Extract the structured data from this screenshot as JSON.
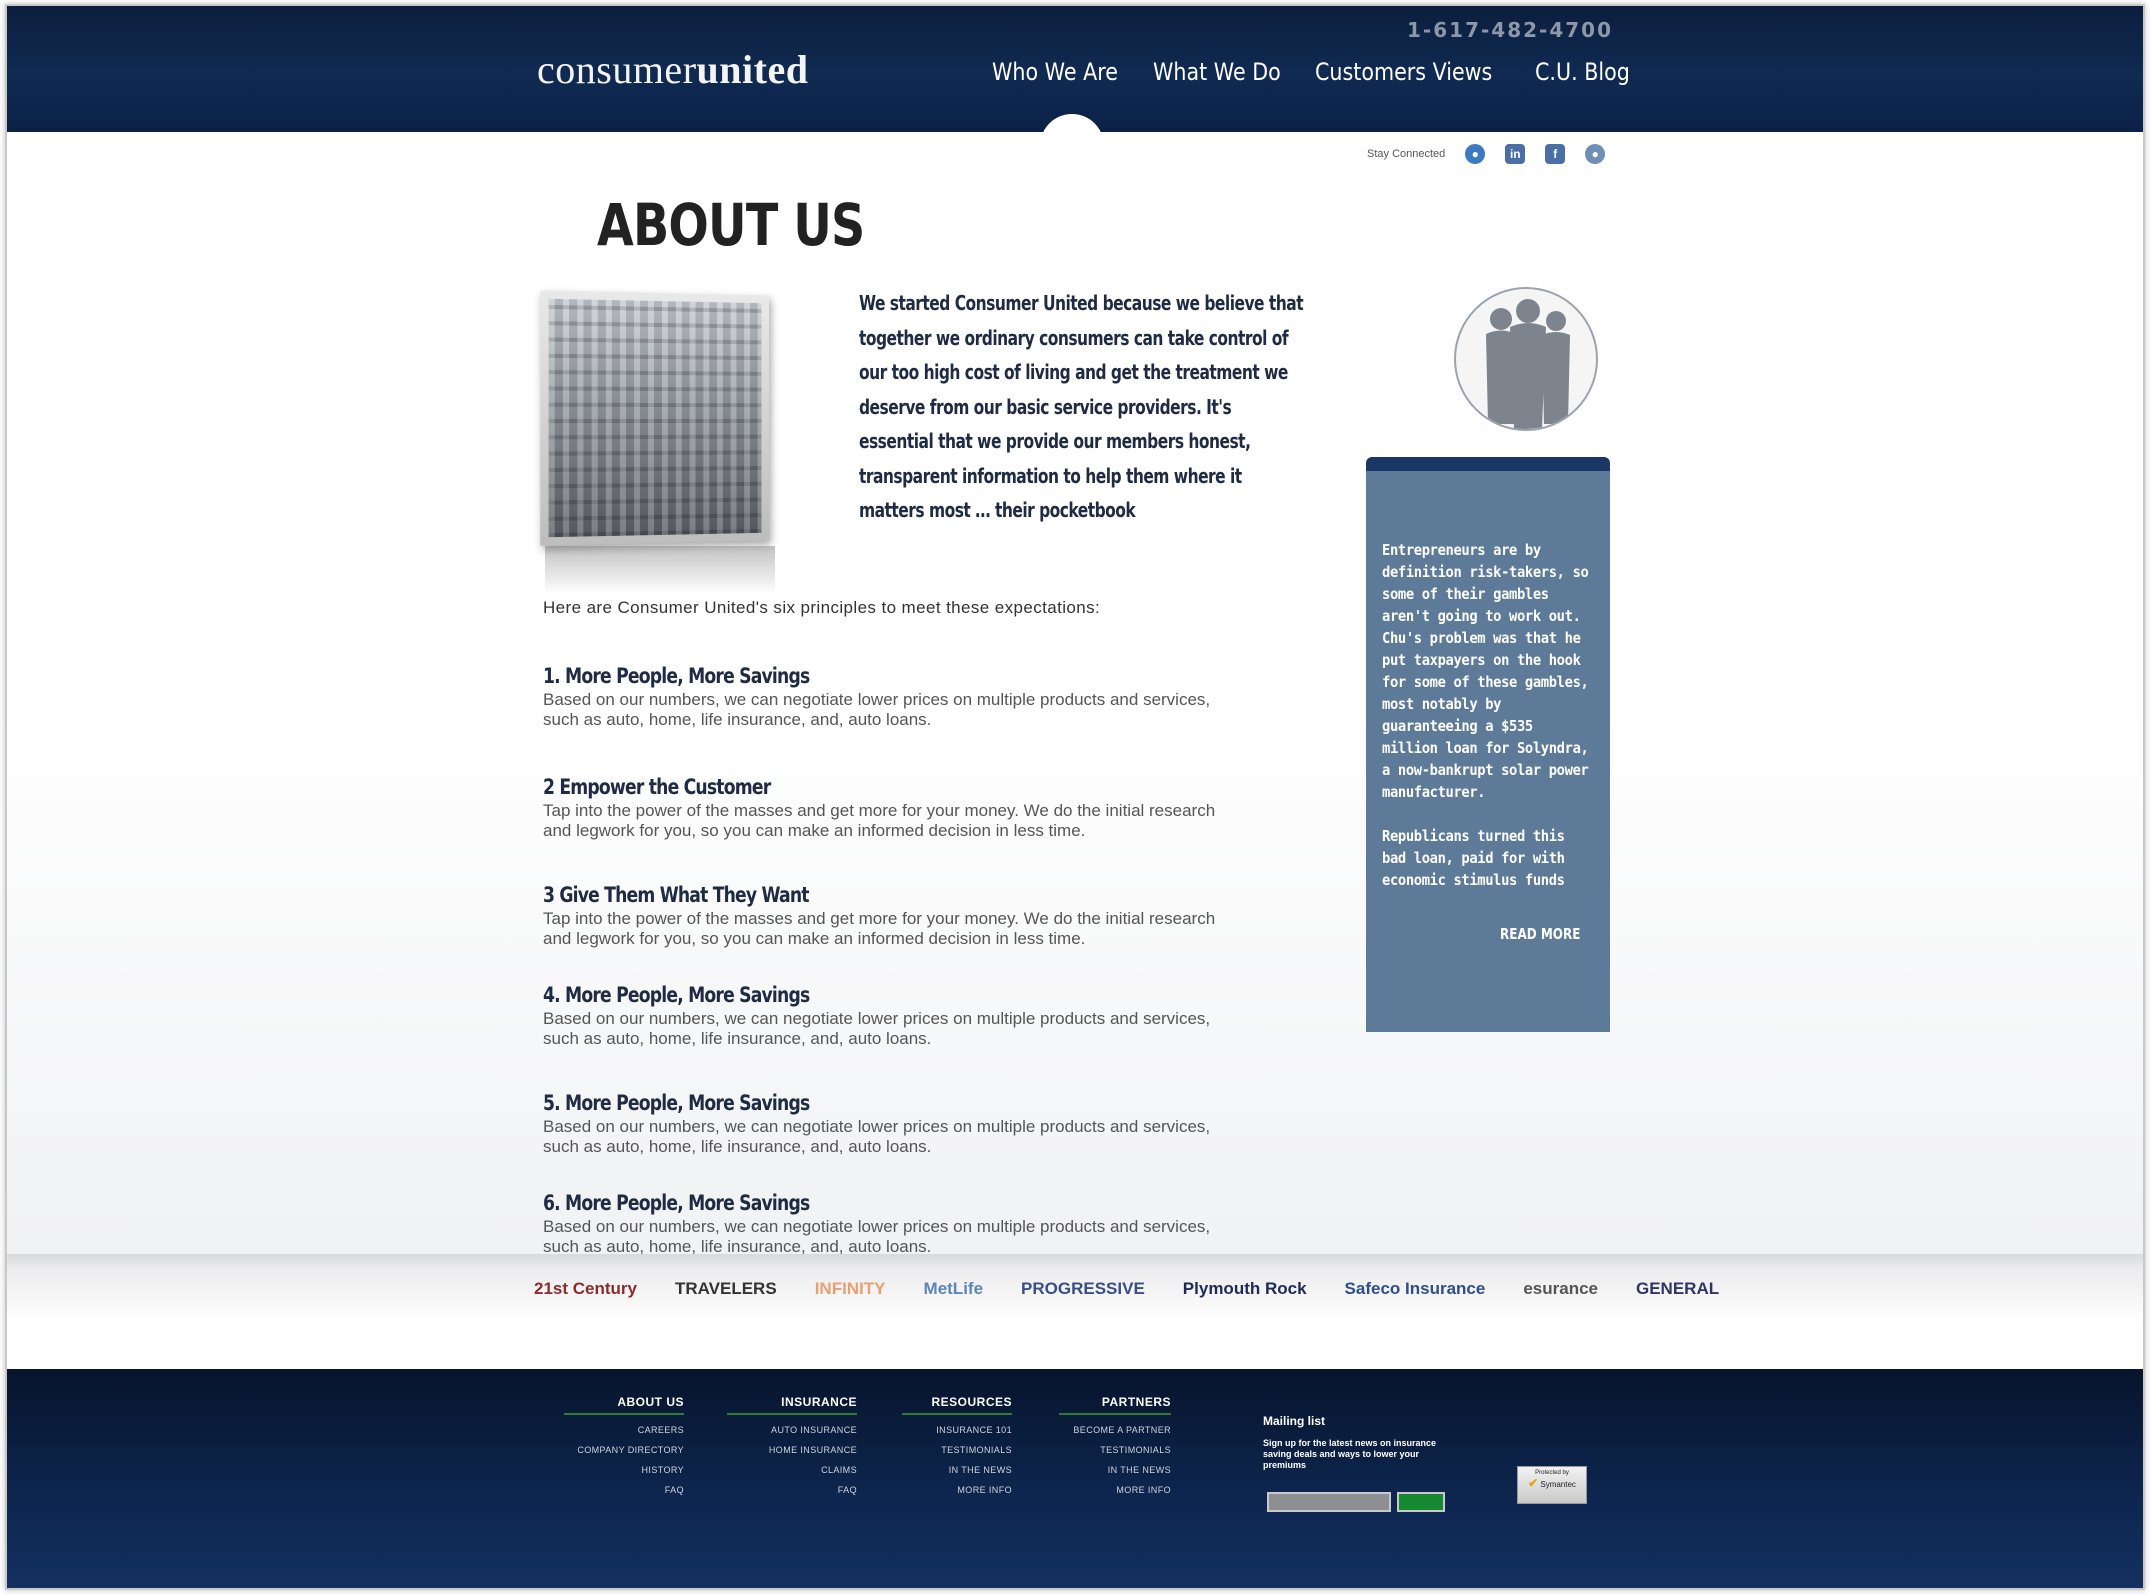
{
  "header": {
    "phone": "1-617-482-4700",
    "logo_light": "consumer",
    "logo_bold": "united",
    "nav": [
      "Who We Are",
      "What We Do",
      "Customers Views",
      "C.U. Blog"
    ]
  },
  "social": {
    "label": "Stay Connected"
  },
  "main": {
    "title": "ABOUT US",
    "intro": "We started Consumer United because we believe that together we ordinary consumers can take control of our too high cost of living and get the treatment we deserve from our basic service providers. It's essential that we provide our members honest, transparent information to help them where it matters most … their pocketbook",
    "principles_intro": "Here are Consumer United's six principles to meet these expectations:",
    "principles": [
      {
        "title": "1.  More People, More Savings",
        "text": "Based on our numbers, we can negotiate lower prices on multiple products and services, such as auto, home, life insurance, and, auto loans."
      },
      {
        "title": "2 Empower the Customer",
        "text": "Tap into the power of the masses and get more for your money. We do the initial research and legwork for you, so you can make an informed decision in less time."
      },
      {
        "title": "3 Give Them What They Want",
        "text": "Tap into the power of the masses and get more for your money. We do the initial research and legwork for you, so you can make an informed decision in less time."
      },
      {
        "title": "4.  More People, More Savings",
        "text": "Based on our numbers, we can negotiate lower prices on multiple products and services, such as auto, home, life insurance, and, auto loans."
      },
      {
        "title": "5.  More People, More Savings",
        "text": "Based on our numbers, we can negotiate lower prices on multiple products and services, such as auto, home, life insurance, and, auto loans."
      },
      {
        "title": "6.  More People, More Savings",
        "text": "Based on our numbers, we can negotiate lower prices on multiple products and services, such as auto, home, life insurance, and, auto loans."
      }
    ]
  },
  "sidebar": {
    "quote": "Entrepreneurs are by definition risk-takers, so some of their gambles aren't going to work out. Chu's problem was that he put taxpayers on the hook for some of these gambles, most notably by guaranteeing a $535 million loan for Solyndra, a now-bankrupt solar power manufacturer.\n\nRepublicans turned this bad loan, paid for with economic stimulus funds",
    "read_more": "READ MORE"
  },
  "partners": [
    {
      "name": "21st Century",
      "color": "#8a2d2d"
    },
    {
      "name": "TRAVELERS",
      "color": "#333333"
    },
    {
      "name": "INFINITY",
      "color": "#e8a070"
    },
    {
      "name": "MetLife",
      "color": "#5b86b8"
    },
    {
      "name": "PROGRESSIVE",
      "color": "#3a4e86"
    },
    {
      "name": "Plymouth Rock",
      "color": "#1c2a5a"
    },
    {
      "name": "Safeco Insurance",
      "color": "#2e4f8c"
    },
    {
      "name": "esurance",
      "color": "#555555"
    },
    {
      "name": "GENERAL",
      "color": "#333366"
    }
  ],
  "footer": {
    "columns": [
      {
        "title": "ABOUT US",
        "links": [
          "CAREERS",
          "COMPANY DIRECTORY",
          "HISTORY",
          "FAQ"
        ]
      },
      {
        "title": "INSURANCE",
        "links": [
          "AUTO INSURANCE",
          "HOME INSURANCE",
          "CLAIMS",
          "FAQ"
        ]
      },
      {
        "title": "RESOURCES",
        "links": [
          "INSURANCE 101",
          "TESTIMONIALS",
          "IN THE NEWS",
          "MORE INFO"
        ]
      },
      {
        "title": "PARTNERS",
        "links": [
          "BECOME A PARTNER",
          "TESTIMONIALS",
          "IN THE NEWS",
          "MORE INFO"
        ]
      }
    ],
    "mailing_title": "Mailing list",
    "mailing_desc": "Sign up for the latest news on insurance saving deals and ways to lower your premiums",
    "badge_top": "Protected by",
    "badge_name": "Symantec"
  },
  "colors": {
    "header_bg": "#102a52",
    "sidebar_box": "#5d7a99",
    "footer_bg": "#0e2650",
    "footer_underline": "#2f7a36",
    "signup_button": "#16882f"
  }
}
